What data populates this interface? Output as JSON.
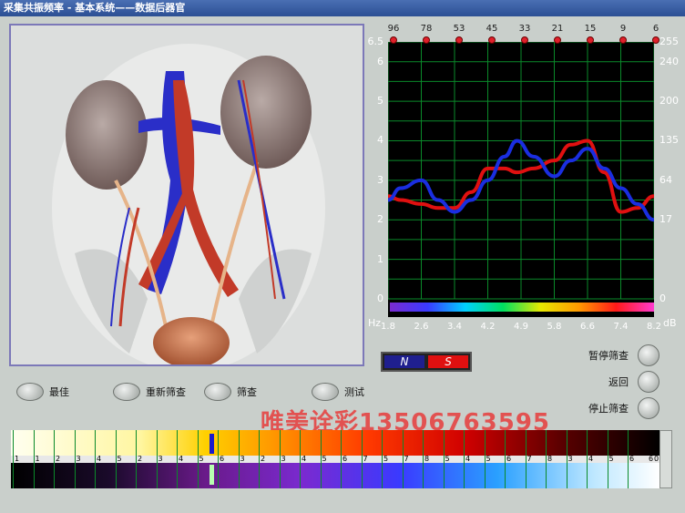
{
  "window": {
    "title": "采集共振频率 - 基本系统——数据后器官"
  },
  "chart_data": {
    "type": "line",
    "x": [
      1.8,
      2.1,
      2.6,
      3.0,
      3.4,
      3.8,
      4.2,
      4.6,
      4.9,
      5.3,
      5.8,
      6.2,
      6.6,
      7.0,
      7.4,
      7.8,
      8.2
    ],
    "series": [
      {
        "color": "#e01010",
        "values": [
          2.6,
          2.5,
          2.4,
          2.3,
          2.3,
          2.7,
          3.3,
          3.3,
          3.2,
          3.3,
          3.5,
          3.9,
          4.0,
          3.2,
          2.2,
          2.3,
          2.6
        ]
      },
      {
        "color": "#1a2ee0",
        "values": [
          2.5,
          2.8,
          3.0,
          2.5,
          2.2,
          2.5,
          3.0,
          3.6,
          4.0,
          3.6,
          3.1,
          3.5,
          3.8,
          3.3,
          2.8,
          2.4,
          2.0
        ]
      }
    ],
    "xlabel": "Hz",
    "ylabel_right": "dB",
    "xlim": [
      1.8,
      8.2
    ],
    "ylim": [
      0,
      6.5
    ],
    "x_ticks": [
      "1.8",
      "2.6",
      "3.4",
      "4.2",
      "4.9",
      "5.8",
      "6.6",
      "7.4",
      "8.2"
    ],
    "y_ticks_left": [
      "6.5",
      "6",
      "5",
      "4",
      "3",
      "2",
      "1",
      "0"
    ],
    "y_ticks_right": [
      "255",
      "240",
      "200",
      "135",
      "64",
      "17",
      "0"
    ],
    "top_marks": [
      "96",
      "78",
      "53",
      "45",
      "33",
      "21",
      "15",
      "9",
      "6"
    ],
    "grid": true,
    "grid_color": "#0a8a2a"
  },
  "buttons_bottom": [
    "最佳",
    "重新筛查",
    "筛查",
    "测试"
  ],
  "buttons_right": [
    "暂停筛查",
    "返回",
    "停止筛查"
  ],
  "ns_toggle": {
    "n": "N",
    "s": "S"
  },
  "watermark": "唯美诠彩13506763595",
  "spectrum_numbers_top": [
    "1",
    "1",
    "2",
    "3",
    "4",
    "5",
    "2",
    "3",
    "4",
    "5",
    "6",
    "3",
    "2",
    "3",
    "4",
    "5",
    "6",
    "7",
    "5",
    "7",
    "8",
    "5",
    "4",
    "5",
    "6",
    "7",
    "8",
    "3",
    "4",
    "5",
    "6"
  ],
  "spectrum_numbers_bottom": [
    "6",
    "0"
  ],
  "colors": {
    "accent_red": "#e01010",
    "accent_blue": "#1a2ee0",
    "panel_border": "#7c78b8"
  }
}
